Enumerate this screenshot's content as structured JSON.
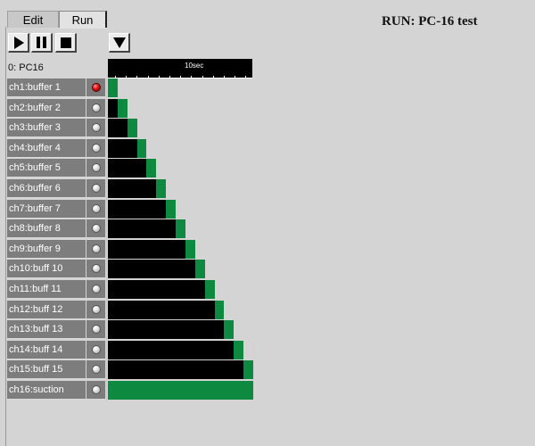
{
  "tabs": [
    {
      "label": "Edit",
      "active": false
    },
    {
      "label": "Run",
      "active": true
    }
  ],
  "run_title": "RUN: PC-16 test",
  "transport": {
    "play_icon": "play-icon",
    "pause_icon": "pause-icon",
    "stop_icon": "stop-icon",
    "menu_icon": "triangle-down-icon"
  },
  "device_label": "0: PC16",
  "timescale": {
    "label": "10sec",
    "ticks_visible": 13
  },
  "colors": {
    "on_segment": "#0d8a3f",
    "off_segment": "#000000",
    "label_bg": "#7d7d7d",
    "led_active": "#e01010"
  },
  "channels": [
    {
      "label": "ch1:buffer 1",
      "led": "on"
    },
    {
      "label": "ch2:buffer 2",
      "led": "off"
    },
    {
      "label": "ch3:buffer 3",
      "led": "off"
    },
    {
      "label": "ch4:buffer 4",
      "led": "off"
    },
    {
      "label": "ch5:buffer 5",
      "led": "off"
    },
    {
      "label": "ch6:buffer 6",
      "led": "off"
    },
    {
      "label": "ch7:buffer 7",
      "led": "off"
    },
    {
      "label": "ch8:buffer 8",
      "led": "off"
    },
    {
      "label": "ch9:buffer 9",
      "led": "off"
    },
    {
      "label": "ch10:buff 10",
      "led": "off"
    },
    {
      "label": "ch11:buff 11",
      "led": "off"
    },
    {
      "label": "ch12:buff 12",
      "led": "off"
    },
    {
      "label": "ch13:buff 13",
      "led": "off"
    },
    {
      "label": "ch14:buff 14",
      "led": "off"
    },
    {
      "label": "ch15:buff 15",
      "led": "off"
    },
    {
      "label": "ch16:suction",
      "led": "off"
    }
  ],
  "schedule": {
    "timeline_seconds": 15,
    "rows": [
      {
        "off_s": 0.0,
        "on_s": 1.0
      },
      {
        "off_s": 1.0,
        "on_s": 1.0
      },
      {
        "off_s": 2.0,
        "on_s": 1.0
      },
      {
        "off_s": 3.0,
        "on_s": 1.0
      },
      {
        "off_s": 4.0,
        "on_s": 1.0
      },
      {
        "off_s": 5.0,
        "on_s": 1.0
      },
      {
        "off_s": 6.0,
        "on_s": 1.0
      },
      {
        "off_s": 7.0,
        "on_s": 1.0
      },
      {
        "off_s": 8.0,
        "on_s": 1.0
      },
      {
        "off_s": 9.0,
        "on_s": 1.0
      },
      {
        "off_s": 10.0,
        "on_s": 1.0
      },
      {
        "off_s": 11.0,
        "on_s": 1.0
      },
      {
        "off_s": 12.0,
        "on_s": 1.0
      },
      {
        "off_s": 13.0,
        "on_s": 1.0
      },
      {
        "off_s": 14.0,
        "on_s": 1.0
      },
      {
        "off_s": 0.0,
        "on_s": 15.0
      }
    ]
  }
}
